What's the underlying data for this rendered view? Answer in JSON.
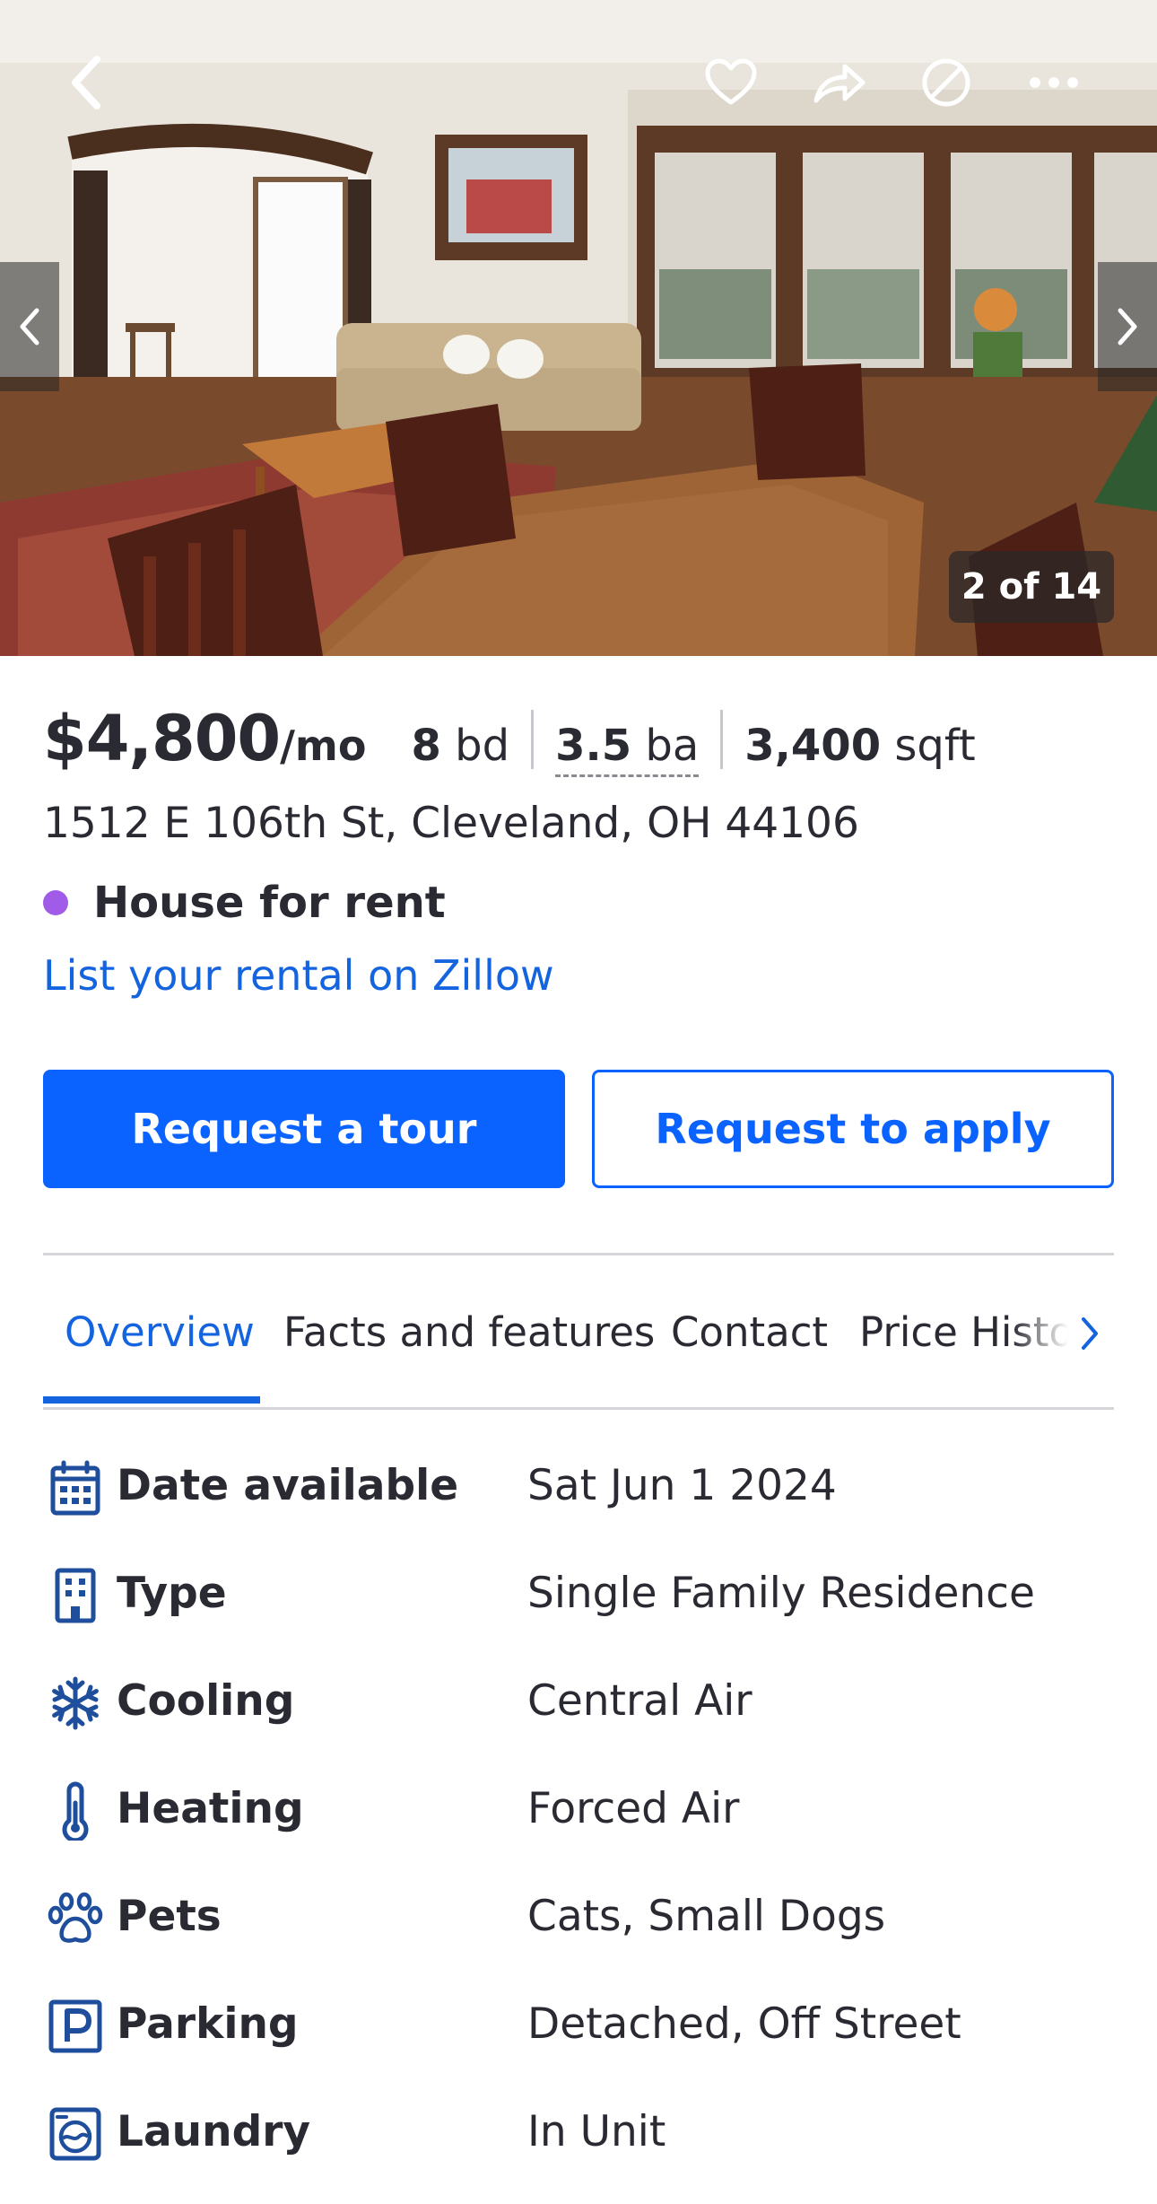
{
  "photo": {
    "counter": "2 of 14",
    "icons": {
      "back": "chevron-left-icon",
      "save": "heart-icon",
      "share": "share-icon",
      "hide": "hide-icon",
      "more": "more-icon",
      "prev": "chevron-left-icon",
      "next": "chevron-right-icon"
    }
  },
  "listing": {
    "price": "$4,800",
    "price_unit": "/mo",
    "beds_value": "8",
    "beds_unit": "bd",
    "baths_value": "3.5",
    "baths_unit": "ba",
    "sqft_value": "3,400",
    "sqft_unit": "sqft",
    "address": "1512 E 106th St, Cleveland, OH 44106",
    "status": "House for rent",
    "status_color": "#a05ce8",
    "list_link": "List your rental on Zillow"
  },
  "actions": {
    "tour": "Request a tour",
    "apply": "Request to apply",
    "primary_color": "#0a63ff"
  },
  "tabs": [
    {
      "label": "Overview",
      "active": true
    },
    {
      "label": "Facts and features",
      "active": false
    },
    {
      "label": "Contact",
      "active": false
    },
    {
      "label": "Price History",
      "active": false
    }
  ],
  "facts": [
    {
      "icon": "calendar-icon",
      "label": "Date available",
      "value": "Sat Jun 1 2024"
    },
    {
      "icon": "building-icon",
      "label": "Type",
      "value": "Single Family Residence"
    },
    {
      "icon": "snowflake-icon",
      "label": "Cooling",
      "value": "Central Air"
    },
    {
      "icon": "thermometer-icon",
      "label": "Heating",
      "value": "Forced Air"
    },
    {
      "icon": "paw-icon",
      "label": "Pets",
      "value": "Cats, Small Dogs"
    },
    {
      "icon": "parking-icon",
      "label": "Parking",
      "value": "Detached, Off Street"
    },
    {
      "icon": "washer-icon",
      "label": "Laundry",
      "value": "In Unit"
    }
  ]
}
